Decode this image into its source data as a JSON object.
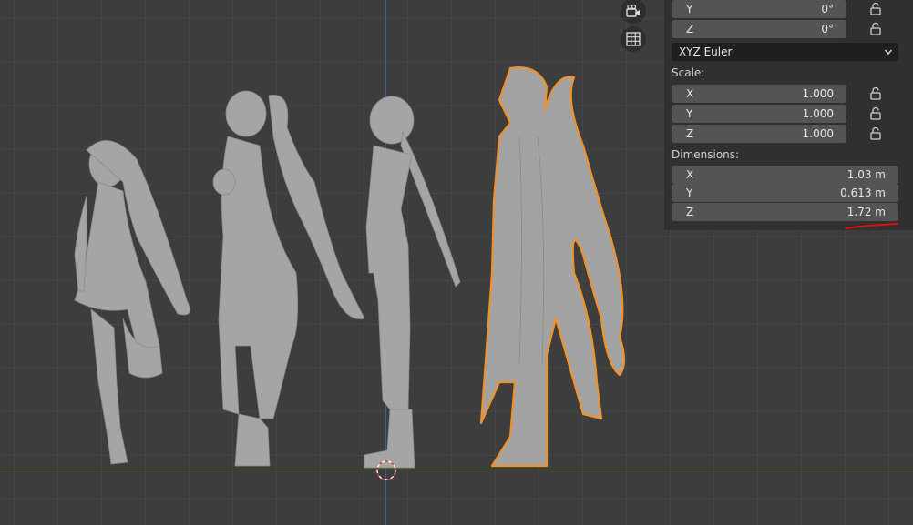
{
  "rotation": {
    "y_label": "Y",
    "y_value": "0°",
    "z_label": "Z",
    "z_value": "0°",
    "mode": "XYZ Euler"
  },
  "scale": {
    "label": "Scale:",
    "x_label": "X",
    "x_value": "1.000",
    "y_label": "Y",
    "y_value": "1.000",
    "z_label": "Z",
    "z_value": "1.000"
  },
  "dimensions": {
    "label": "Dimensions:",
    "x_label": "X",
    "x_value": "1.03 m",
    "y_label": "Y",
    "y_value": "0.613 m",
    "z_label": "Z",
    "z_value": "1.72 m"
  },
  "colors": {
    "selection_outline": "#f0922c",
    "model_fill": "#a7a7a7",
    "annotation_underline": "#e01010",
    "z_axis": "#3e5d9a",
    "ground_axis": "#6a8a3a"
  },
  "icons": {
    "camera": "camera-icon",
    "grid": "grid-icon",
    "lock": "lock-icon",
    "cursor": "3d-cursor-icon"
  }
}
